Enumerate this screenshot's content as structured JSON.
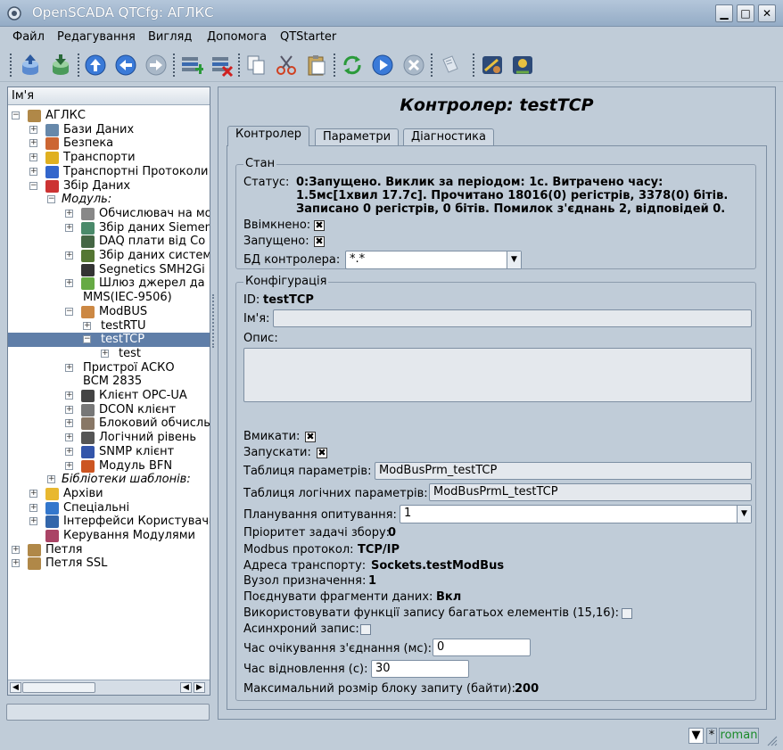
{
  "window": {
    "title": "OpenSCADA QTCfg: АГЛКС"
  },
  "menu": [
    "Файл",
    "Редагування",
    "Вигляд",
    "Допомога",
    "QTStarter"
  ],
  "toolbar": {
    "icons": [
      "db-load-icon",
      "db-save-icon",
      "up-icon",
      "back-icon",
      "forward-icon",
      "add-item-icon",
      "delete-item-icon",
      "copy-icon",
      "cut-icon",
      "paste-icon",
      "refresh-icon",
      "start-icon",
      "stop-icon",
      "info-icon",
      "module-tool-icon",
      "module-tool-2-icon"
    ]
  },
  "tree": {
    "header": "Ім'я",
    "items": [
      {
        "label": "АГЛКС",
        "level": 0,
        "expander": "−",
        "icon": "#b08848"
      },
      {
        "label": "Бази Даних",
        "level": 1,
        "expander": "+",
        "icon": "#6688aa"
      },
      {
        "label": "Безпека",
        "level": 1,
        "expander": "+",
        "icon": "#cc6633"
      },
      {
        "label": "Транспорти",
        "level": 1,
        "expander": "+",
        "icon": "#e0b020"
      },
      {
        "label": "Транспортні Протоколи",
        "level": 1,
        "expander": "+",
        "icon": "#3366cc"
      },
      {
        "label": "Збір Даних",
        "level": 1,
        "expander": "−",
        "icon": "#cc3333"
      },
      {
        "label": "Модуль:",
        "level": 2,
        "expander": "−",
        "icon": "",
        "italic": true
      },
      {
        "label": "Обчислювач на мо",
        "level": 3,
        "expander": "+",
        "icon": "#888888"
      },
      {
        "label": "Збір даних Siemen",
        "level": 3,
        "expander": "+",
        "icon": "#4a8a6a"
      },
      {
        "label": "DAQ плати від Со",
        "level": 3,
        "expander": "",
        "icon": "#446644"
      },
      {
        "label": "Збір даних систем",
        "level": 3,
        "expander": "+",
        "icon": "#557733"
      },
      {
        "label": "Segnetics SMH2Gi",
        "level": 3,
        "expander": "",
        "icon": "#333333"
      },
      {
        "label": "Шлюз джерел да",
        "level": 3,
        "expander": "+",
        "icon": "#66aa44"
      },
      {
        "label": "MMS(IEC-9506)",
        "level": 3,
        "expander": "",
        "icon": ""
      },
      {
        "label": "ModBUS",
        "level": 3,
        "expander": "−",
        "icon": "#cc8844"
      },
      {
        "label": "testRTU",
        "level": 4,
        "expander": "+",
        "icon": ""
      },
      {
        "label": "testTCP",
        "level": 4,
        "expander": "−",
        "icon": "",
        "selected": true
      },
      {
        "label": "test",
        "level": 5,
        "expander": "+",
        "icon": ""
      },
      {
        "label": "Пристрої АСКО",
        "level": 3,
        "expander": "+",
        "icon": ""
      },
      {
        "label": "BCM 2835",
        "level": 3,
        "expander": "",
        "icon": ""
      },
      {
        "label": "Клієнт OPC-UA",
        "level": 3,
        "expander": "+",
        "icon": "#444444"
      },
      {
        "label": "DCON клієнт",
        "level": 3,
        "expander": "+",
        "icon": "#777777"
      },
      {
        "label": "Блоковий обчисль",
        "level": 3,
        "expander": "+",
        "icon": "#887766"
      },
      {
        "label": "Логічний рівень",
        "level": 3,
        "expander": "+",
        "icon": "#555555"
      },
      {
        "label": "SNMP клієнт",
        "level": 3,
        "expander": "+",
        "icon": "#3355aa"
      },
      {
        "label": "Модуль BFN",
        "level": 3,
        "expander": "+",
        "icon": "#cc5522"
      },
      {
        "label": "Бібліотеки шаблонів:",
        "level": 2,
        "expander": "+",
        "icon": "",
        "italic": true
      },
      {
        "label": "Архіви",
        "level": 1,
        "expander": "+",
        "icon": "#e8b830"
      },
      {
        "label": "Спеціальні",
        "level": 1,
        "expander": "+",
        "icon": "#3377cc"
      },
      {
        "label": "Інтерфейси Користувача",
        "level": 1,
        "expander": "+",
        "icon": "#3366aa"
      },
      {
        "label": "Керування Модулями",
        "level": 1,
        "expander": "",
        "icon": "#aa4466"
      },
      {
        "label": "Петля",
        "level": 0,
        "expander": "+",
        "icon": "#b08848"
      },
      {
        "label": "Петля SSL",
        "level": 0,
        "expander": "+",
        "icon": "#b08848"
      }
    ]
  },
  "main": {
    "title": "Контролер: testTCP",
    "tabs": [
      "Контролер",
      "Параметри",
      "Діагностика"
    ],
    "state": {
      "group_label": "Стан",
      "status_label": "Статус:",
      "status_lines": [
        "0:Запущено. Виклик за періодом: 1с. Витрачено часу:",
        "1.5мс[1хвил 17.7с]. Прочитано 18016(0) регістрів, 3378(0) бітів.",
        "Записано 0 регістрів, 0 бітів. Помилок з'єднань 2, відповідей 0."
      ],
      "enabled_label": "Ввімкнено:",
      "started_label": "Запущено:",
      "db_label": "БД контролера:",
      "db_value": "*.*"
    },
    "config": {
      "group_label": "Конфігурація",
      "id_label": "ID:",
      "id_value": "testTCP",
      "name_label": "Ім'я:",
      "name_value": "",
      "descr_label": "Опис:",
      "enable_label": "Вмикати:",
      "start_label": "Запускати:",
      "prm_table_label": "Таблиця параметрів:",
      "prm_table_value": "ModBusPrm_testTCP",
      "prml_table_label": "Таблиця логічних параметрів:",
      "prml_table_value": "ModBusPrmL_testTCP",
      "schedule_label": "Планування опитування:",
      "schedule_value": "1",
      "priority_label": "Пріоритет задачі збору:",
      "priority_value": "0",
      "protocol_label": "Modbus протокол:",
      "protocol_value": "TCP/IP",
      "transport_label": "Адреса транспорту:",
      "transport_value": "Sockets.testModBus",
      "node_label": "Вузол призначення:",
      "node_value": "1",
      "merge_label": "Поєднувати фрагменти даних:",
      "merge_value": "Вкл",
      "multiwrite_label": "Використовувати функції запису багатьох елементів (15,16):",
      "async_label": "Асинхроний запис:",
      "conn_timeout_label": "Час очікування з'єднання (мс):",
      "conn_timeout_value": "0",
      "restore_label": "Час відновлення (с):",
      "restore_value": "30",
      "max_block_label": "Максимальний розмір блоку запиту (байти):",
      "max_block_value": "200"
    }
  },
  "statusbar": {
    "user": "roman",
    "modified": "*"
  }
}
